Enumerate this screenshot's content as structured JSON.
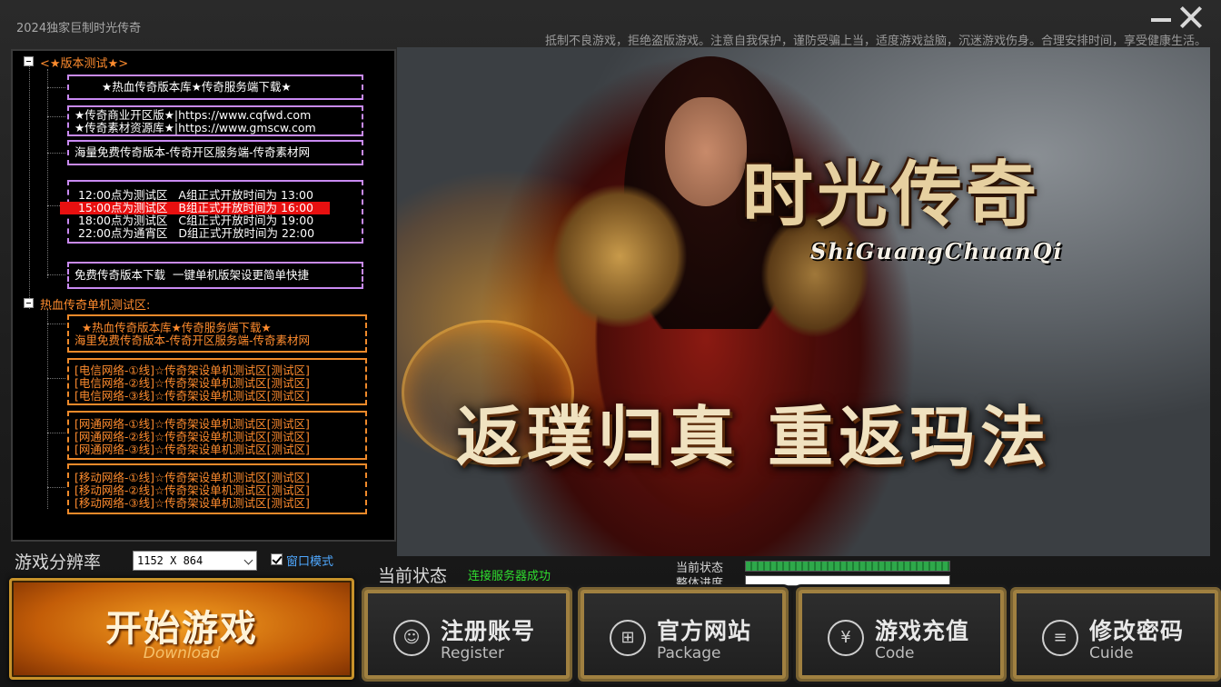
{
  "window": {
    "title": "2024独家巨制时光传奇",
    "notice": "抵制不良游戏，拒绝盗版游戏。注意自我保护，谨防受骗上当，适度游戏益脑，沉迷游戏伤身。合理安排时间，享受健康生活。"
  },
  "tree": {
    "group1": {
      "label": "<★版本测试★>",
      "box1": {
        "line1": "★热血传奇版本库★传奇服务端下载★"
      },
      "box2": {
        "line1": "★传奇商业开区版★|https://www.cqfwd.com",
        "line2": "★传奇素材资源库★|https://www.gmscw.com"
      },
      "box3": {
        "line1": "海量免费传奇版本-传奇开区服务端-传奇素材网"
      },
      "box4": {
        "line1": " 12:00点为测试区   A组正式开放时间为 13:00",
        "line2": " 15:00点为测试区   B组正式开放时间为 16:00",
        "line3": " 18:00点为测试区   C组正式开放时间为 19:00",
        "line4": " 22:00点为通宵区   D组正式开放时间为 22:00"
      },
      "box5": {
        "line1": "免费传奇版本下载  一键单机版架设更简单快捷"
      }
    },
    "group2": {
      "label": "热血传奇单机测试区:",
      "box1": {
        "line1": "  ★热血传奇版本库★传奇服务端下载★",
        "line2": "海里免费传奇版本-传奇开区服务端-传奇素材网"
      },
      "box2": {
        "line1": "[电信网络-①线]☆传奇架设单机测试区[测试区]",
        "line2": "[电信网络-②线]☆传奇架设单机测试区[测试区]",
        "line3": "[电信网络-③线]☆传奇架设单机测试区[测试区]"
      },
      "box3": {
        "line1": "[网通网络-①线]☆传奇架设单机测试区[测试区]",
        "line2": "[网通网络-②线]☆传奇架设单机测试区[测试区]",
        "line3": "[网通网络-③线]☆传奇架设单机测试区[测试区]"
      },
      "box4": {
        "line1": "[移动网络-①线]☆传奇架设单机测试区[测试区]",
        "line2": "[移动网络-②线]☆传奇架设单机测试区[测试区]",
        "line3": "[移动网络-③线]☆传奇架设单机测试区[测试区]"
      }
    }
  },
  "hero": {
    "logo_main": "时光传奇",
    "logo_sub": "ShiGuangChuanQi",
    "slogan": "返璞归真 重返玛法"
  },
  "controls": {
    "resolution_label": "游戏分辨率",
    "resolution_value": "1152 X 864",
    "window_mode_label": "窗口模式",
    "window_mode_checked": true
  },
  "status": {
    "label": "当前状态",
    "value": "连接服务器成功",
    "current_label": "当前状态",
    "current_progress": 1.0,
    "overall_label": "整体进度",
    "overall_progress": 0.0
  },
  "buttons": {
    "start_main": "开始游戏",
    "start_sub": "Download",
    "register": {
      "label": "注册账号",
      "sub": "Register"
    },
    "website": {
      "label": "官方网站",
      "sub": "Package"
    },
    "recharge": {
      "label": "游戏充值",
      "sub": "Code"
    },
    "password": {
      "label": "修改密码",
      "sub": "Cuide"
    }
  },
  "colors": {
    "tree_purple": "#c98af2",
    "tree_orange": "#f08a2a",
    "highlight_red": "#e81010",
    "status_green": "#2fdc2f",
    "link_blue": "#4fa8ff"
  },
  "icons": {
    "register": "user-icon",
    "website": "gift-icon",
    "recharge": "yuan-icon",
    "password": "document-icon"
  }
}
